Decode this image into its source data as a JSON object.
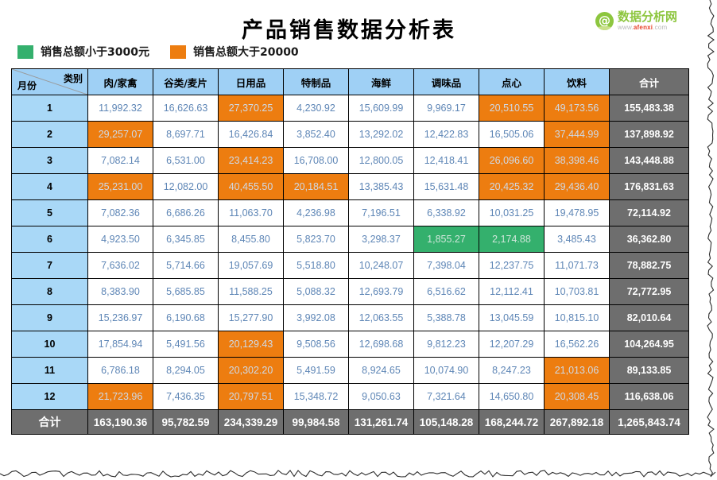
{
  "document": {
    "title": "产品销售数据分析表"
  },
  "brand": {
    "mark_glyph": "@",
    "name": "数据分析网",
    "url_prefix": "www.",
    "url_mid": "afenxi",
    "url_suffix": ".com"
  },
  "legend": {
    "items": [
      {
        "label": "销售总额小于3000元",
        "color": "#34b06d"
      },
      {
        "label": "销售总额大于20000",
        "color": "#ed7d10"
      }
    ]
  },
  "table": {
    "corner": {
      "category_label": "类别",
      "month_label": "月份"
    },
    "categories": [
      "肉/家禽",
      "谷类/麦片",
      "日用品",
      "特制品",
      "海鲜",
      "调味品",
      "点心",
      "饮料"
    ],
    "total_header": "合计",
    "footer_label": "合计",
    "rows": [
      {
        "month": "1",
        "values": [
          "11,992.32",
          "16,626.63",
          "27,370.25",
          "4,230.92",
          "15,609.99",
          "9,969.17",
          "20,510.55",
          "49,173.56"
        ],
        "flags": [
          "",
          "",
          "orange",
          "",
          "",
          "",
          "orange",
          "orange"
        ],
        "total": "155,483.38"
      },
      {
        "month": "2",
        "values": [
          "29,257.07",
          "8,697.71",
          "16,426.84",
          "3,852.40",
          "13,292.02",
          "12,422.83",
          "16,505.06",
          "37,444.99"
        ],
        "flags": [
          "orange",
          "",
          "",
          "",
          "",
          "",
          "",
          "orange"
        ],
        "total": "137,898.92"
      },
      {
        "month": "3",
        "values": [
          "7,082.14",
          "6,531.00",
          "23,414.23",
          "16,708.00",
          "12,800.05",
          "12,418.41",
          "26,096.60",
          "38,398.46"
        ],
        "flags": [
          "",
          "",
          "orange",
          "",
          "",
          "",
          "orange",
          "orange"
        ],
        "total": "143,448.88"
      },
      {
        "month": "4",
        "values": [
          "25,231.00",
          "12,082.00",
          "40,455.50",
          "20,184.51",
          "13,385.43",
          "15,631.48",
          "20,425.32",
          "29,436.40"
        ],
        "flags": [
          "orange",
          "",
          "orange",
          "orange",
          "",
          "",
          "orange",
          "orange"
        ],
        "total": "176,831.63"
      },
      {
        "month": "5",
        "values": [
          "7,082.36",
          "6,686.26",
          "11,063.70",
          "4,236.98",
          "7,196.51",
          "6,338.92",
          "10,031.25",
          "19,478.95"
        ],
        "flags": [
          "",
          "",
          "",
          "",
          "",
          "",
          "",
          ""
        ],
        "total": "72,114.92"
      },
      {
        "month": "6",
        "values": [
          "4,923.50",
          "6,345.85",
          "8,455.80",
          "5,823.70",
          "3,298.37",
          "1,855.27",
          "2,174.88",
          "3,485.43"
        ],
        "flags": [
          "",
          "",
          "",
          "",
          "",
          "green",
          "green",
          ""
        ],
        "total": "36,362.80"
      },
      {
        "month": "7",
        "values": [
          "7,636.02",
          "5,714.66",
          "19,057.69",
          "5,518.80",
          "10,248.07",
          "7,398.04",
          "12,237.75",
          "11,071.73"
        ],
        "flags": [
          "",
          "",
          "",
          "",
          "",
          "",
          "",
          ""
        ],
        "total": "78,882.75"
      },
      {
        "month": "8",
        "values": [
          "8,383.90",
          "5,685.85",
          "11,588.25",
          "5,088.32",
          "12,693.79",
          "6,516.62",
          "12,112.41",
          "10,703.81"
        ],
        "flags": [
          "",
          "",
          "",
          "",
          "",
          "",
          "",
          ""
        ],
        "total": "72,772.95"
      },
      {
        "month": "9",
        "values": [
          "15,236.97",
          "6,190.68",
          "15,277.90",
          "3,992.08",
          "12,063.55",
          "5,388.78",
          "13,045.59",
          "10,815.10"
        ],
        "flags": [
          "",
          "",
          "",
          "",
          "",
          "",
          "",
          ""
        ],
        "total": "82,010.64"
      },
      {
        "month": "10",
        "values": [
          "17,854.94",
          "5,491.56",
          "20,129.43",
          "9,508.56",
          "12,698.68",
          "9,812.23",
          "12,207.29",
          "16,562.26"
        ],
        "flags": [
          "",
          "",
          "orange",
          "",
          "",
          "",
          "",
          ""
        ],
        "total": "104,264.95"
      },
      {
        "month": "11",
        "values": [
          "6,786.18",
          "8,294.05",
          "20,302.20",
          "5,491.59",
          "8,924.65",
          "10,074.90",
          "8,247.23",
          "21,013.06"
        ],
        "flags": [
          "",
          "",
          "orange",
          "",
          "",
          "",
          "",
          "orange"
        ],
        "total": "89,133.85"
      },
      {
        "month": "12",
        "values": [
          "21,723.96",
          "7,436.35",
          "20,797.51",
          "15,348.72",
          "9,050.63",
          "7,321.64",
          "14,650.80",
          "20,308.45"
        ],
        "flags": [
          "orange",
          "",
          "orange",
          "",
          "",
          "",
          "",
          "orange"
        ],
        "total": "116,638.06"
      }
    ],
    "footer_values": [
      "163,190.36",
      "95,782.59",
      "234,339.29",
      "99,984.58",
      "131,261.74",
      "105,148.28",
      "168,244.72",
      "267,892.18"
    ],
    "grand_total": "1,265,843.74"
  },
  "colors": {
    "header_blue": "#9fd0f5",
    "month_blue": "#a9d8f7",
    "gray_total": "#6e6e6e",
    "orange": "#ed7d10",
    "green": "#34b06d",
    "value_text": "#5e86b6",
    "brand_green": "#8dc63f",
    "brand_red": "#e8442a"
  }
}
